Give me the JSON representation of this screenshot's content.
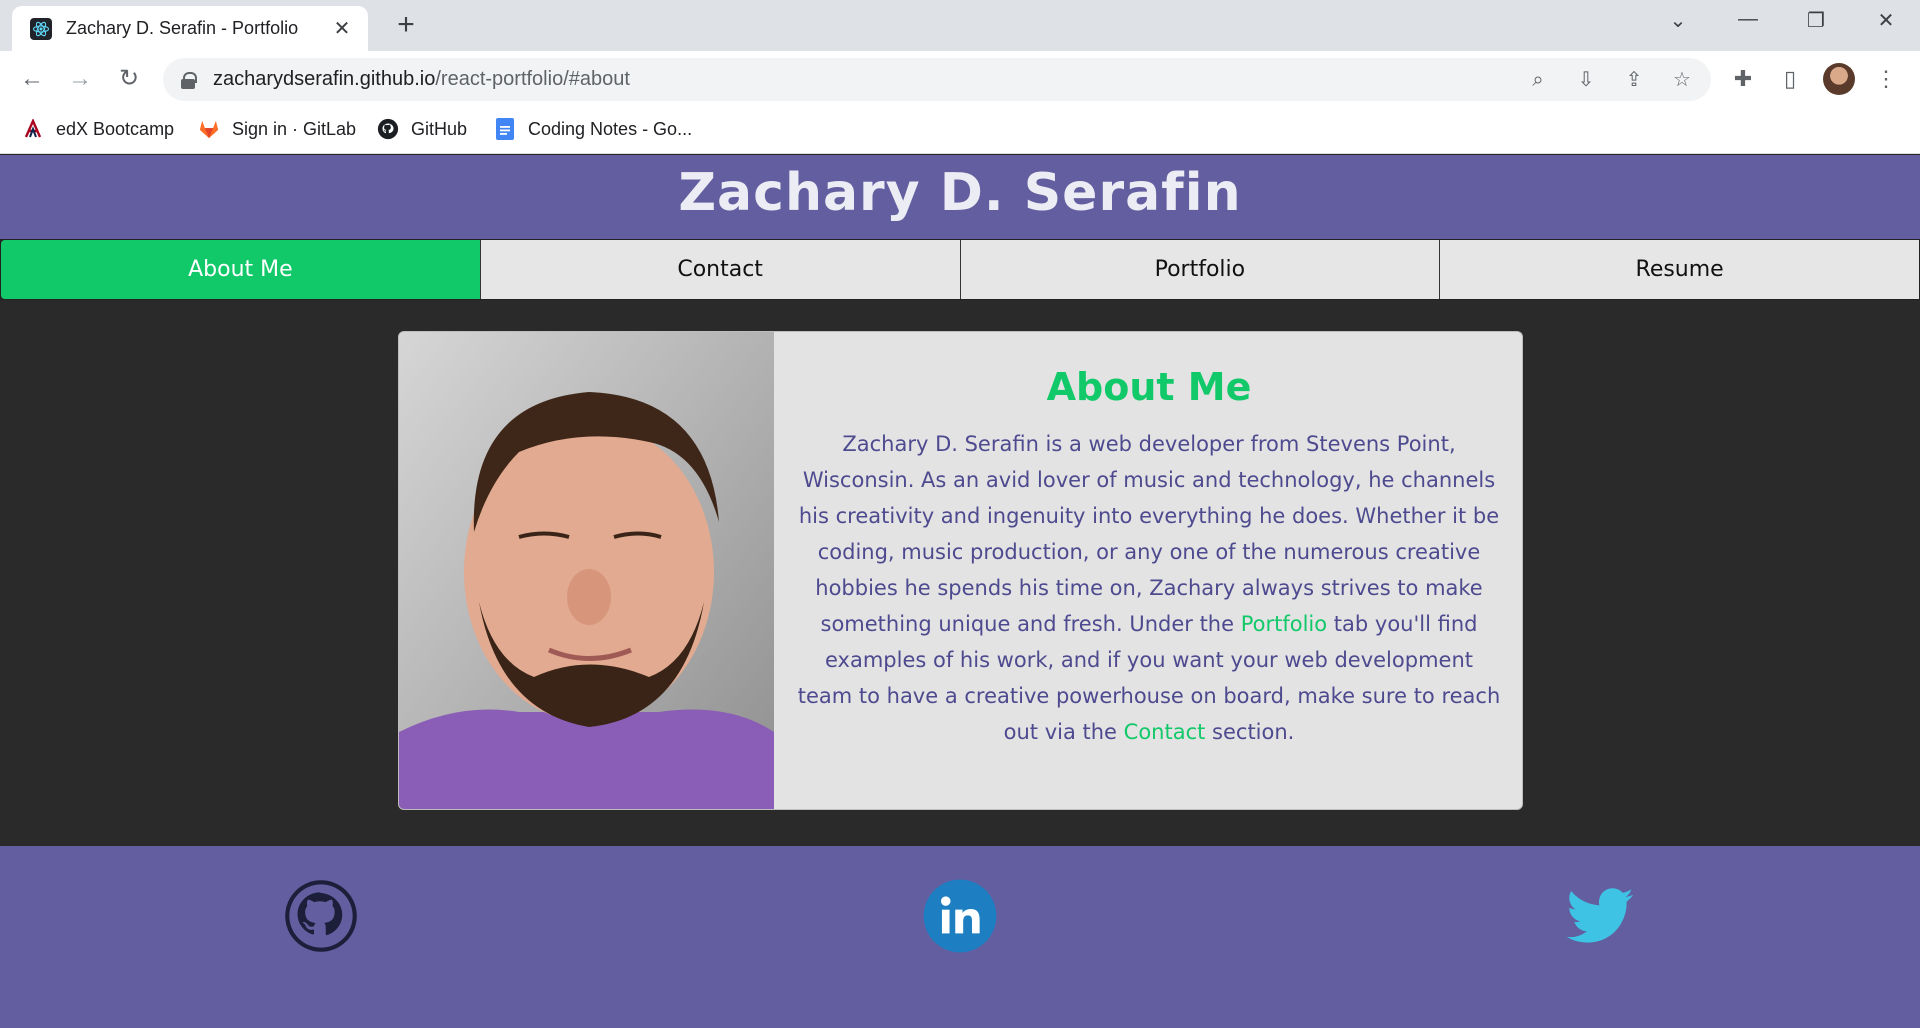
{
  "browser": {
    "tab_title": "Zachary D. Serafin - Portfolio",
    "url_host": "zacharydserafin.github.io",
    "url_path": "/react-portfolio/#about",
    "bookmarks": [
      {
        "label": "edX Bootcamp",
        "icon": "edx-icon"
      },
      {
        "label": "Sign in · GitLab",
        "icon": "gitlab-icon"
      },
      {
        "label": "GitHub",
        "icon": "github-icon"
      },
      {
        "label": "Coding Notes - Go...",
        "icon": "google-docs-icon"
      }
    ]
  },
  "header": {
    "title": "Zachary D. Serafin"
  },
  "nav": {
    "tabs": [
      {
        "label": "About Me",
        "active": true
      },
      {
        "label": "Contact",
        "active": false
      },
      {
        "label": "Portfolio",
        "active": false
      },
      {
        "label": "Resume",
        "active": false
      }
    ]
  },
  "about": {
    "title": "About Me",
    "text_part1": "Zachary D. Serafin is a web developer from Stevens Point, Wisconsin. As an avid lover of music and technology, he channels his creativity and ingenuity into everything he does. Whether it be coding, music production, or any one of the numerous creative hobbies he spends his time on, Zachary always strives to make something unique and fresh. Under the ",
    "link_portfolio": "Portfolio",
    "text_part2": " tab you'll find examples of his work, and if you want your web development team to have a creative powerhouse on board, make sure to reach out via the ",
    "link_contact": "Contact",
    "text_part3": " section."
  },
  "footer": {
    "socials": [
      {
        "name": "github-icon",
        "color": "#1b1f3a"
      },
      {
        "name": "linkedin-icon",
        "color": "#1d7fc2"
      },
      {
        "name": "twitter-icon",
        "color": "#3ec3e4"
      }
    ]
  },
  "colors": {
    "header_bg": "#625e9f",
    "accent_green": "#12c96a",
    "body_bg": "#2a2a2a",
    "card_bg": "#e3e3e3"
  }
}
